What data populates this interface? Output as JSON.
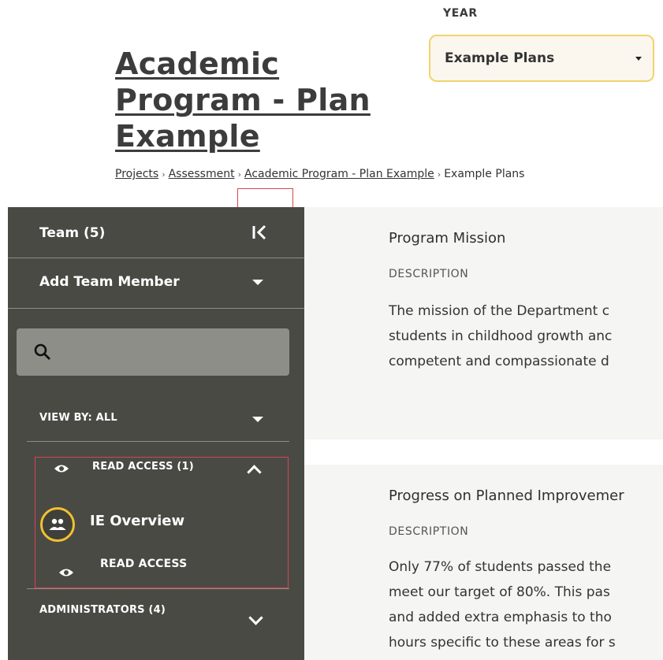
{
  "header": {
    "title": "Academic Program - Plan Example",
    "breadcrumb": [
      "Projects",
      "Assessment",
      "Academic Program - Plan Example",
      "Example Plans"
    ],
    "breadcrumb_separator": "›",
    "year_label": "YEAR",
    "year_selected": "Example Plans"
  },
  "sidebar": {
    "team_title": "Team (5)",
    "add_member_label": "Add Team Member",
    "search_placeholder": "",
    "view_by_label": "VIEW BY: ALL",
    "read_access_group": {
      "label": "READ ACCESS (1)",
      "members": [
        {
          "name": "IE Overview",
          "access": "READ ACCESS"
        }
      ]
    },
    "administrators_group": {
      "label": "ADMINISTRATORS (4)"
    }
  },
  "main": {
    "sections": [
      {
        "title": "Program Mission",
        "description_label": "DESCRIPTION",
        "lines": [
          "The mission of the Department c",
          "students in childhood growth anc",
          "competent and compassionate d"
        ]
      },
      {
        "title": "Progress on Planned Improvemer",
        "description_label": "DESCRIPTION",
        "lines": [
          "Only 77% of students passed the",
          "meet our target of 80%. This pas",
          "and added extra emphasis to tho",
          "hours specific to these areas for s"
        ]
      }
    ]
  },
  "colors": {
    "sidebar_bg": "#4a4a45",
    "accent_yellow": "#f2c12e",
    "highlight_red": "#d9434f",
    "panel_bg": "#f5f5f4"
  }
}
